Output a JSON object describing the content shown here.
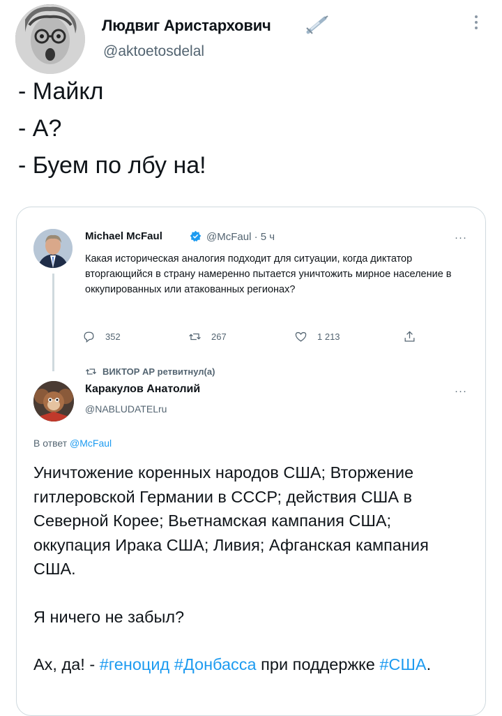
{
  "author": {
    "name": "Людвиг Аристархович",
    "badge_icon": "syringe-icon",
    "handle": "@aktoetosdelal",
    "more_icon": "vertical-dots-icon"
  },
  "tweet_lines": [
    "- Майкл",
    "- А?",
    "- Буем по лбу на!"
  ],
  "quoted": {
    "name": "Michael McFaul",
    "verified_icon": "verified-badge-icon",
    "meta": "@McFaul · 5 ч",
    "more": "···",
    "text": "Какая историческая аналогия подходит для ситуации, когда диктатор вторгающийся в страну намеренно пытается уничтожить мирное население в оккупированных или атакованных регионах?",
    "actions": {
      "reply_count": "352",
      "retweet_count": "267",
      "like_count": "1 213"
    },
    "retweet_note": "ВИКТОР АР ретвитнул(а)"
  },
  "reply": {
    "name": "Каракулов Анатолий",
    "handle": "@NABLUDATELru",
    "more": "···",
    "reply_to_prefix": "В ответ",
    "reply_to_mention": "@McFaul",
    "paragraph1": "Уничтожение коренных народов США; Вторжение гитлеровской Германии в СССР; действия США в Северной Корее; Вьетнамская кампания США; оккупация Ирака США; Ливия; Афганская кампания США.",
    "paragraph2": "Я ничего не забыл?",
    "paragraph3_prefix": "Ах, да! - ",
    "tag1": "#геноцид",
    "tag2": "#Донбасса",
    "paragraph3_middle": " при поддержке ",
    "tag3": "#США",
    "paragraph3_end": "."
  },
  "colors": {
    "link": "#1d9bf0",
    "secondary_text": "#536471",
    "border": "#cfd9de"
  }
}
